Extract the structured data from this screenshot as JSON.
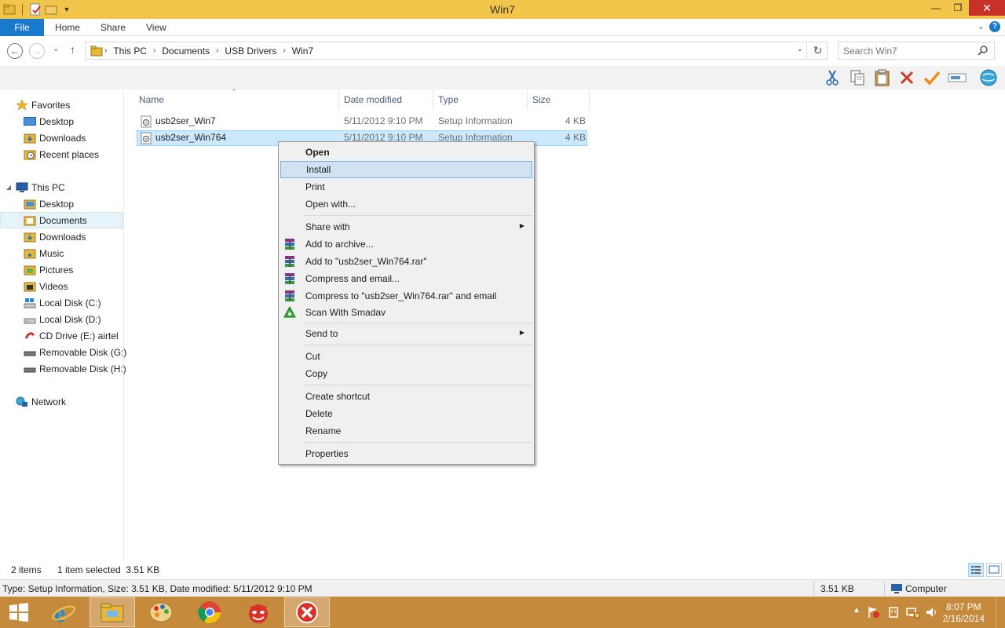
{
  "window": {
    "title": "Win7",
    "controls": {
      "minimize": "—",
      "maximize": "❐",
      "close": "✕"
    }
  },
  "ribbon": {
    "tabs": [
      "File",
      "Home",
      "Share",
      "View"
    ],
    "expand": "⌄",
    "help": "?"
  },
  "address": {
    "back": "←",
    "forward": "→",
    "recent": "⌄",
    "up": "↑",
    "crumbs": [
      "This PC",
      "Documents",
      "USB Drivers",
      "Win7"
    ],
    "crumb_sep": "›",
    "dropdown": "⌄",
    "refresh": "↻",
    "search_placeholder": "Search Win7"
  },
  "toolbar": {
    "icons": [
      "cut-icon",
      "copy-icon",
      "paste-icon",
      "delete-icon",
      "check-icon",
      "rename-icon",
      "globe-icon"
    ]
  },
  "nav": {
    "items": [
      {
        "label": "Favorites",
        "icon": "star-icon",
        "level": 0
      },
      {
        "label": "Desktop",
        "icon": "desktop-icon",
        "level": 1
      },
      {
        "label": "Downloads",
        "icon": "folder-icon",
        "level": 1
      },
      {
        "label": "Recent places",
        "icon": "recent-icon",
        "level": 1
      },
      {
        "label": "This PC",
        "icon": "computer-icon",
        "level": 0
      },
      {
        "label": "Desktop",
        "icon": "folder-icon",
        "level": 1
      },
      {
        "label": "Documents",
        "icon": "folder-icon",
        "level": 1
      },
      {
        "label": "Downloads",
        "icon": "folder-icon",
        "level": 1
      },
      {
        "label": "Music",
        "icon": "folder-icon",
        "level": 1
      },
      {
        "label": "Pictures",
        "icon": "folder-icon",
        "level": 1
      },
      {
        "label": "Videos",
        "icon": "folder-icon",
        "level": 1
      },
      {
        "label": "Local Disk (C:)",
        "icon": "drive-icon",
        "level": 1
      },
      {
        "label": "Local Disk (D:)",
        "icon": "drive-icon",
        "level": 1
      },
      {
        "label": "CD Drive (E:) airtel",
        "icon": "cd-icon",
        "level": 1
      },
      {
        "label": "Removable Disk (G:)",
        "icon": "removable-icon",
        "level": 1
      },
      {
        "label": "Removable Disk (H:)",
        "icon": "removable-icon",
        "level": 1
      },
      {
        "label": "Network",
        "icon": "network-icon",
        "level": 0
      }
    ],
    "selected": "Documents"
  },
  "files": {
    "columns": [
      "Name",
      "Date modified",
      "Type",
      "Size"
    ],
    "sort_arrow": "^",
    "rows": [
      {
        "name": "usb2ser_Win7",
        "date": "5/11/2012 9:10 PM",
        "type": "Setup Information",
        "size": "4 KB"
      },
      {
        "name": "usb2ser_Win764",
        "date": "5/11/2012 9:10 PM",
        "type": "Setup Information",
        "size": "4 KB"
      }
    ],
    "selected_index": 1
  },
  "context_menu": {
    "submenu_arrow": "▶",
    "items": [
      {
        "label": "Open",
        "bold": true
      },
      {
        "label": "Install",
        "hover": true
      },
      {
        "label": "Print"
      },
      {
        "label": "Open with..."
      },
      {
        "label": "Share with",
        "submenu": true
      },
      {
        "label": "Add to archive...",
        "icon": "winrar-icon"
      },
      {
        "label": "Add to \"usb2ser_Win764.rar\"",
        "icon": "winrar-icon"
      },
      {
        "label": "Compress and email...",
        "icon": "winrar-icon"
      },
      {
        "label": "Compress to \"usb2ser_Win764.rar\" and email",
        "icon": "winrar-icon"
      },
      {
        "label": "Scan With Smadav",
        "icon": "smadav-icon"
      },
      {
        "label": "Send to",
        "submenu": true
      },
      {
        "label": "Cut"
      },
      {
        "label": "Copy"
      },
      {
        "label": "Create shortcut"
      },
      {
        "label": "Delete"
      },
      {
        "label": "Rename"
      },
      {
        "label": "Properties"
      }
    ]
  },
  "status": {
    "items_count": "2 items",
    "selection": "1 item selected  3.51 KB"
  },
  "infobar": {
    "details": "Type: Setup Information, Size: 3.51 KB, Date modified: 5/11/2012 9:10 PM",
    "size": "3.51 KB",
    "location": "Computer"
  },
  "taskbar": {
    "apps": [
      "start-icon",
      "internet-explorer-icon",
      "file-explorer-icon",
      "paint-icon",
      "chrome-icon",
      "devil-app-icon",
      "error-app-icon"
    ],
    "clock_time": "8:07 PM",
    "clock_date": "2/16/2014",
    "tray_expand": "▲"
  },
  "colors": {
    "titlebar": "#f0c54a",
    "file_tab": "#1979ca",
    "close_button": "#c7312a",
    "selection": "#cce8ff",
    "taskbar": "#c58a3c"
  }
}
